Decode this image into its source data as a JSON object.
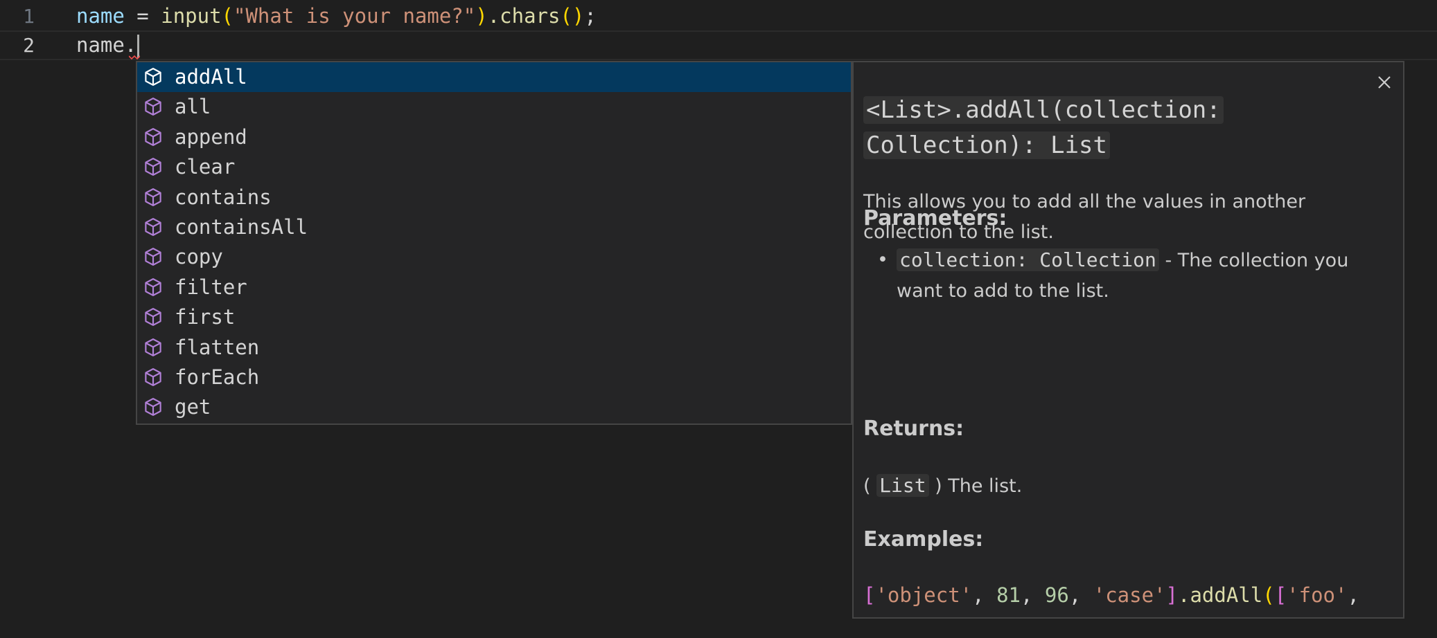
{
  "editor": {
    "line1": {
      "number": "1",
      "tokens": {
        "var": "name",
        "eq": " = ",
        "fn": "input",
        "open": "(",
        "str": "\"What is your name?\"",
        "close": ")",
        "method": ".chars",
        "call": "()",
        "semi": ";"
      }
    },
    "line2": {
      "number": "2",
      "text": "name."
    }
  },
  "suggest": {
    "icon": "symbol-method-cube-icon",
    "items": [
      {
        "label": "addAll"
      },
      {
        "label": "all"
      },
      {
        "label": "append"
      },
      {
        "label": "clear"
      },
      {
        "label": "contains"
      },
      {
        "label": "containsAll"
      },
      {
        "label": "copy"
      },
      {
        "label": "filter"
      },
      {
        "label": "first"
      },
      {
        "label": "flatten"
      },
      {
        "label": "forEach"
      },
      {
        "label": "get"
      }
    ],
    "selected_index": 0
  },
  "details": {
    "close_icon": "close-icon",
    "signature_line1": "<List>.addAll(collection:",
    "signature_line2": "Collection): List",
    "description": "This allows you to add all the values in another collection to the list.",
    "parameters_heading": "Parameters:",
    "param_bullet": "•",
    "param_code": "collection: Collection",
    "param_text": " - The collection you want to add to the list.",
    "returns_heading": "Returns:",
    "returns_open": "( ",
    "returns_code": "List",
    "returns_text": " ) The list.",
    "examples_heading": "Examples:",
    "example": {
      "b1": "[",
      "s1": "'object'",
      "c1": ", ",
      "n1": "81",
      "c2": ", ",
      "n2": "96",
      "c3": ", ",
      "s2": "'case'",
      "b2": "]",
      "fn": ".addAll",
      "p1": "(",
      "b3": "[",
      "s3": "'foo'",
      "c4": ","
    }
  },
  "colors": {
    "background": "#1f1f1f",
    "selection": "#04395e",
    "icon_purple": "#b180d7",
    "string": "#ce9178",
    "number": "#b5cea8",
    "function": "#dcdcaa",
    "variable": "#9cdcfe"
  }
}
